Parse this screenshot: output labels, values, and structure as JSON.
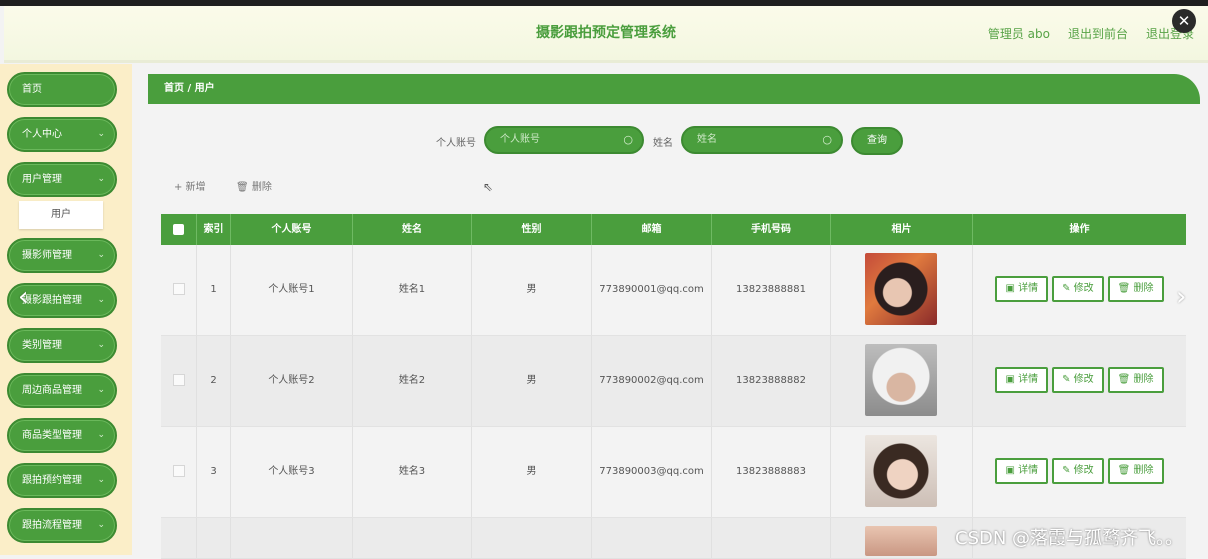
{
  "header": {
    "title": "摄影跟拍预定管理系统",
    "user": "管理员 abo",
    "exit_front": "退出到前台",
    "logout": "退出登录"
  },
  "sidebar": {
    "items": [
      {
        "label": "首页"
      },
      {
        "label": "个人中心"
      },
      {
        "label": "用户管理"
      },
      {
        "label": "摄影师管理"
      },
      {
        "label": "摄影跟拍管理"
      },
      {
        "label": "类别管理"
      },
      {
        "label": "周边商品管理"
      },
      {
        "label": "商品类型管理"
      },
      {
        "label": "跟拍预约管理"
      },
      {
        "label": "跟拍流程管理"
      }
    ],
    "submenu": "用户"
  },
  "breadcrumb": "首页 / 用户",
  "search": {
    "account_label": "个人账号",
    "account_placeholder": "个人账号",
    "name_label": "姓名",
    "name_placeholder": "姓名",
    "query_button": "查询"
  },
  "toolbar": {
    "add": "+ 新增",
    "delete": "删除"
  },
  "table": {
    "headers": [
      "索引",
      "个人账号",
      "姓名",
      "性别",
      "邮箱",
      "手机号码",
      "相片",
      "操作"
    ],
    "rows": [
      {
        "index": "1",
        "account": "个人账号1",
        "name": "姓名1",
        "gender": "男",
        "email": "773890001@qq.com",
        "phone": "13823888881"
      },
      {
        "index": "2",
        "account": "个人账号2",
        "name": "姓名2",
        "gender": "男",
        "email": "773890002@qq.com",
        "phone": "13823888882"
      },
      {
        "index": "3",
        "account": "个人账号3",
        "name": "姓名3",
        "gender": "男",
        "email": "773890003@qq.com",
        "phone": "13823888883"
      }
    ],
    "actions": {
      "detail": "详情",
      "edit": "修改",
      "delete": "删除"
    }
  },
  "watermark": "CSDN @落霞与孤鹜齐飞。。",
  "colors": {
    "accent": "#4a9e3d",
    "sidebar_bg": "#fbeec8",
    "header_text": "#4a9e3d"
  },
  "icons": [
    "close-icon",
    "chevron-down-icon",
    "search-icon",
    "plus-icon",
    "trash-icon",
    "detail-icon",
    "edit-icon",
    "cursor-icon",
    "arrow-left-icon",
    "arrow-right-icon"
  ]
}
